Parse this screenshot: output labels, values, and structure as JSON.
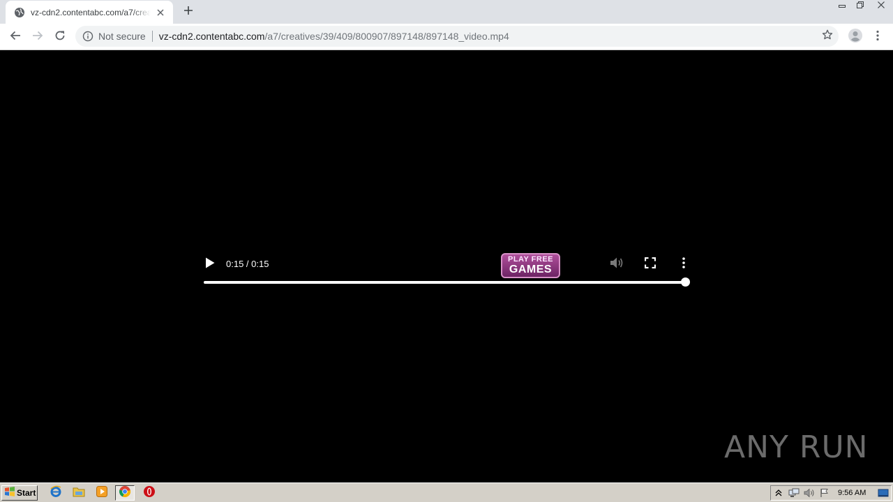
{
  "browser": {
    "tab": {
      "title": "vz-cdn2.contentabc.com/a7/creatives/39/409/800907/897148/897148_video.mp4",
      "favicon": "globe-icon"
    },
    "new_tab_icon": "plus-icon",
    "window_controls": [
      "minimize-icon",
      "restore-icon",
      "close-icon"
    ]
  },
  "toolbar": {
    "back_icon": "arrow-left-icon",
    "forward_icon": "arrow-right-icon",
    "reload_icon": "reload-icon",
    "security_label": "Not secure",
    "url_host": "vz-cdn2.contentabc.com",
    "url_path": "/a7/creatives/39/409/800907/897148/897148_video.mp4",
    "bookmark_icon": "star-icon",
    "profile_icon": "account-icon",
    "menu_icon": "kebab-menu-icon"
  },
  "video": {
    "time_display": "0:15 / 0:15",
    "progress_fraction": 1.0,
    "ad_line1": "PLAY FREE",
    "ad_line2": "GAMES",
    "play_icon": "play-icon",
    "mute_icon": "volume-icon",
    "fullscreen_icon": "fullscreen-icon",
    "more_icon": "more-options-icon"
  },
  "watermark": {
    "text": "ANY RUN"
  },
  "taskbar": {
    "start_label": "Start",
    "apps": [
      "ie-icon",
      "explorer-icon",
      "media-player-icon",
      "chrome-icon",
      "opera-icon"
    ],
    "clock": "9:56 AM"
  },
  "colors": {
    "tabstrip": "#dee1e6",
    "omnibox": "#f1f3f4",
    "taskbar": "#d4d0c8",
    "ad_badge": "#8d3a82"
  }
}
